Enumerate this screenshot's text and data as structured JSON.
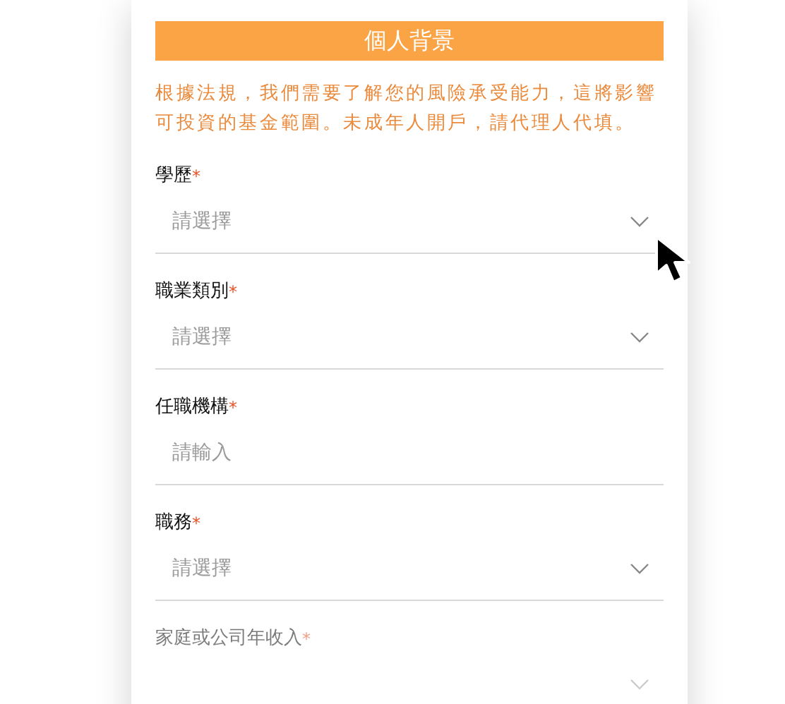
{
  "header": {
    "title": "個人背景"
  },
  "notice": "根據法規，我們需要了解您的風險承受能力，這將影響可投資的基金範圍。未成年人開戶，請代理人代填。",
  "fields": [
    {
      "label": "學歷",
      "required_mark": "*",
      "kind": "select",
      "placeholder": "請選擇"
    },
    {
      "label": "職業類別",
      "required_mark": "*",
      "kind": "select",
      "placeholder": "請選擇"
    },
    {
      "label": "任職機構",
      "required_mark": "*",
      "kind": "input",
      "placeholder": "請輸入"
    },
    {
      "label": "職務",
      "required_mark": "*",
      "kind": "select",
      "placeholder": "請選擇"
    },
    {
      "label": "家庭或公司年收入",
      "required_mark": "*",
      "kind": "select"
    }
  ]
}
